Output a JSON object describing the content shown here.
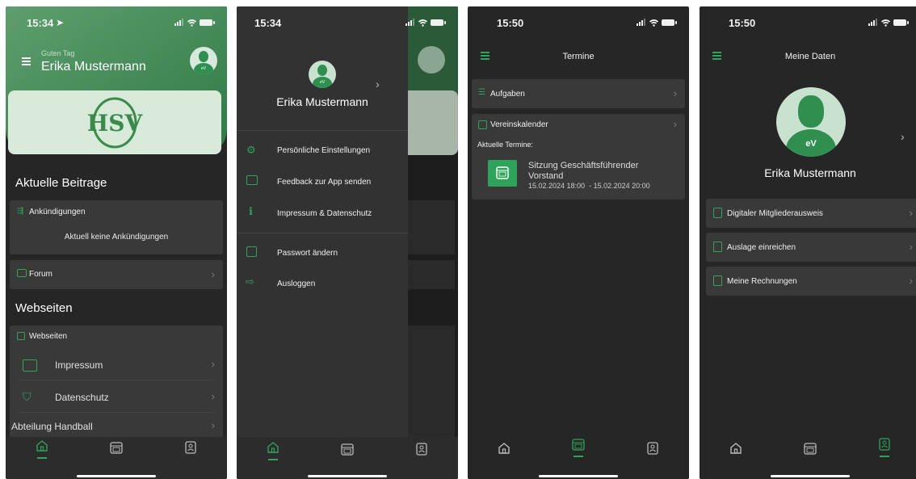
{
  "colors": {
    "accent": "#2fa35a",
    "background": "#262626",
    "card": "#393939",
    "drawer": "#323232"
  },
  "screen1": {
    "time": "15:34",
    "greeting": "Guten Tag",
    "user_name": "Erika Mustermann",
    "logo_text": "HSV",
    "avatar_text": "eV",
    "section_news": "Aktuelle Beitrage",
    "announcements_title": "Ankündigungen",
    "announcements_empty": "Aktuell keine Ankündigungen",
    "forum": "Forum",
    "section_websites": "Webseiten",
    "websites_title": "Webseiten",
    "links": [
      {
        "label": "Impressum",
        "icon": "browser-icon"
      },
      {
        "label": "Datenschutz",
        "icon": "privacy-icon"
      },
      {
        "label": "Abteilung Handball",
        "icon": ""
      }
    ]
  },
  "screen2": {
    "time": "15:34",
    "user_name": "Erika Mustermann",
    "avatar_text": "eV",
    "menu": [
      {
        "label": "Persönliche Einstellungen",
        "icon": "gears-icon"
      },
      {
        "label": "Feedback zur App senden",
        "icon": "message-icon"
      },
      {
        "label": "Impressum & Datenschutz",
        "icon": "info-icon"
      },
      {
        "label": "Passwort ändern",
        "icon": "lock-icon"
      },
      {
        "label": "Ausloggen",
        "icon": "logout-icon"
      }
    ]
  },
  "screen3": {
    "time": "15:50",
    "title": "Termine",
    "tasks": "Aufgaben",
    "calendar": "Vereinskalender",
    "current": "Aktuelle Termine:",
    "event_title": "Sitzung Geschäftsführender Vorstand",
    "event_time": "15.02.2024 18:00  - 15.02.2024 20:00"
  },
  "screen4": {
    "time": "15:50",
    "title": "Meine Daten",
    "avatar_text": "eV",
    "user_name": "Erika Mustermann",
    "rows": [
      {
        "label": "Digitaler Mitgliederausweis",
        "icon": "id-card-icon"
      },
      {
        "label": "Auslage einreichen",
        "icon": "document-icon"
      },
      {
        "label": "Meine Rechnungen",
        "icon": "invoice-icon"
      }
    ]
  }
}
